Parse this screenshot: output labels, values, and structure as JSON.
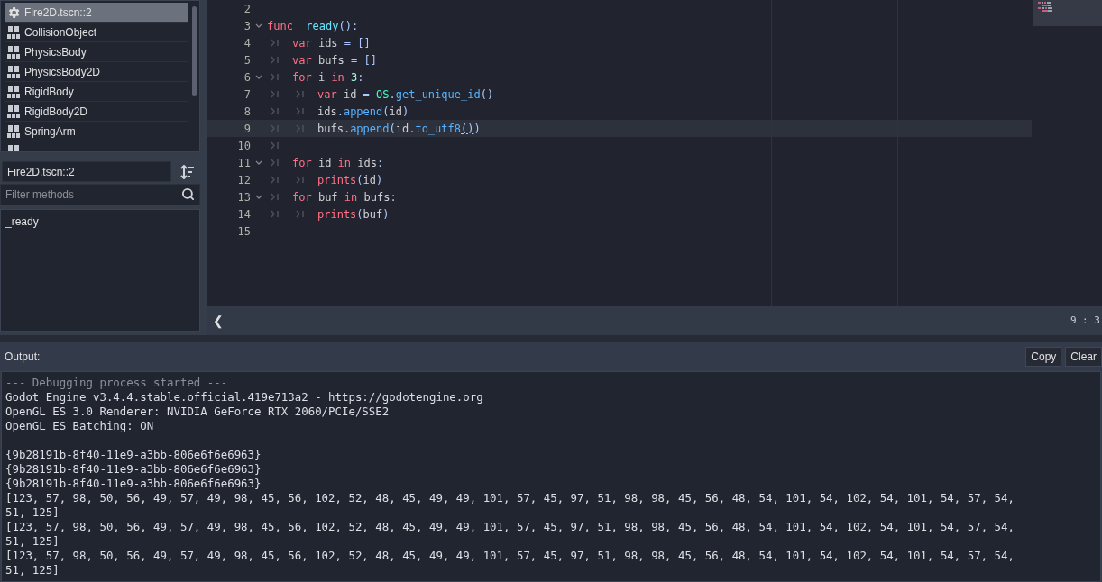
{
  "scene_list": {
    "items": [
      {
        "label": "Fire2D.tscn::2",
        "kind": "script",
        "selected": true
      },
      {
        "label": "CollisionObject",
        "kind": "doc",
        "selected": false
      },
      {
        "label": "PhysicsBody",
        "kind": "doc",
        "selected": false
      },
      {
        "label": "PhysicsBody2D",
        "kind": "doc",
        "selected": false
      },
      {
        "label": "RigidBody",
        "kind": "doc",
        "selected": false
      },
      {
        "label": "RigidBody2D",
        "kind": "doc",
        "selected": false
      },
      {
        "label": "SpringArm",
        "kind": "doc",
        "selected": false
      },
      {
        "kind": "doc",
        "selected": false
      }
    ]
  },
  "script_name": "Fire2D.tscn::2",
  "filter": {
    "placeholder": "Filter methods"
  },
  "methods": [
    "_ready"
  ],
  "code_lines": [
    {
      "number": "2",
      "foldable": false,
      "current": false
    },
    {
      "number": "3",
      "foldable": true,
      "current": false,
      "tokens": [
        {
          "kind": "keyword",
          "text": "func"
        },
        {
          "kind": "function",
          "text": " _ready"
        },
        {
          "kind": "symbol",
          "text": "():"
        }
      ]
    },
    {
      "number": "4",
      "foldable": false,
      "current": false,
      "tokens": [
        {
          "kind": "tab"
        },
        {
          "kind": "keyword",
          "text": "var"
        },
        {
          "kind": "plain",
          "text": " ids "
        },
        {
          "kind": "symbol",
          "text": "= []"
        }
      ]
    },
    {
      "number": "5",
      "foldable": false,
      "current": false,
      "tokens": [
        {
          "kind": "tab"
        },
        {
          "kind": "keyword",
          "text": "var"
        },
        {
          "kind": "plain",
          "text": " bufs "
        },
        {
          "kind": "symbol",
          "text": "= []"
        }
      ]
    },
    {
      "number": "6",
      "foldable": true,
      "current": false,
      "tokens": [
        {
          "kind": "tab"
        },
        {
          "kind": "keyword",
          "text": "for"
        },
        {
          "kind": "plain",
          "text": " i "
        },
        {
          "kind": "keyword",
          "text": "in"
        },
        {
          "kind": "number",
          "text": " 3"
        },
        {
          "kind": "symbol",
          "text": ":"
        }
      ]
    },
    {
      "number": "7",
      "foldable": false,
      "current": false,
      "tokens": [
        {
          "kind": "tab"
        },
        {
          "kind": "tab"
        },
        {
          "kind": "keyword",
          "text": "var"
        },
        {
          "kind": "plain",
          "text": " id "
        },
        {
          "kind": "symbol",
          "text": "= "
        },
        {
          "kind": "class",
          "text": "OS"
        },
        {
          "kind": "symbol",
          "text": "."
        },
        {
          "kind": "method",
          "text": "get_unique_id"
        },
        {
          "kind": "symbol",
          "text": "()"
        }
      ]
    },
    {
      "number": "8",
      "foldable": false,
      "current": false,
      "tokens": [
        {
          "kind": "tab"
        },
        {
          "kind": "tab"
        },
        {
          "kind": "plain",
          "text": "ids"
        },
        {
          "kind": "symbol",
          "text": "."
        },
        {
          "kind": "method",
          "text": "append"
        },
        {
          "kind": "symbol",
          "text": "("
        },
        {
          "kind": "plain",
          "text": "id"
        },
        {
          "kind": "symbol",
          "text": ")"
        }
      ]
    },
    {
      "number": "9",
      "foldable": false,
      "current": true,
      "tokens": [
        {
          "kind": "tab"
        },
        {
          "kind": "tab"
        },
        {
          "kind": "plain",
          "text": "bufs"
        },
        {
          "kind": "symbol",
          "text": "."
        },
        {
          "kind": "method",
          "text": "append"
        },
        {
          "kind": "symbol",
          "text": "("
        },
        {
          "kind": "plain",
          "text": "id"
        },
        {
          "kind": "symbol",
          "text": "."
        },
        {
          "kind": "method",
          "text": "to_utf8"
        },
        {
          "kind": "matched",
          "text": "()"
        },
        {
          "kind": "symbol",
          "text": ")"
        }
      ]
    },
    {
      "number": "10",
      "foldable": false,
      "current": false,
      "tokens": [
        {
          "kind": "tab"
        }
      ]
    },
    {
      "number": "11",
      "foldable": true,
      "current": false,
      "tokens": [
        {
          "kind": "tab"
        },
        {
          "kind": "keyword",
          "text": "for"
        },
        {
          "kind": "plain",
          "text": " id "
        },
        {
          "kind": "keyword",
          "text": "in"
        },
        {
          "kind": "plain",
          "text": " ids"
        },
        {
          "kind": "symbol",
          "text": ":"
        }
      ]
    },
    {
      "number": "12",
      "foldable": false,
      "current": false,
      "tokens": [
        {
          "kind": "tab"
        },
        {
          "kind": "tab"
        },
        {
          "kind": "builtin",
          "text": "prints"
        },
        {
          "kind": "symbol",
          "text": "("
        },
        {
          "kind": "plain",
          "text": "id"
        },
        {
          "kind": "symbol",
          "text": ")"
        }
      ]
    },
    {
      "number": "13",
      "foldable": true,
      "current": false,
      "tokens": [
        {
          "kind": "tab"
        },
        {
          "kind": "keyword",
          "text": "for"
        },
        {
          "kind": "plain",
          "text": " buf "
        },
        {
          "kind": "keyword",
          "text": "in"
        },
        {
          "kind": "plain",
          "text": " bufs"
        },
        {
          "kind": "symbol",
          "text": ":"
        }
      ]
    },
    {
      "number": "14",
      "foldable": false,
      "current": false,
      "tokens": [
        {
          "kind": "tab"
        },
        {
          "kind": "tab"
        },
        {
          "kind": "builtin",
          "text": "prints"
        },
        {
          "kind": "symbol",
          "text": "("
        },
        {
          "kind": "plain",
          "text": "buf"
        },
        {
          "kind": "symbol",
          "text": ")"
        }
      ]
    },
    {
      "number": "15",
      "foldable": false,
      "current": false
    }
  ],
  "editor_status": {
    "back": "❮",
    "position": "9 : 3"
  },
  "output": {
    "title": "Output:",
    "buttons": [
      "Copy",
      "Clear"
    ],
    "lines": [
      {
        "kind": "system",
        "text": "--- Debugging process started ---"
      },
      {
        "kind": "plain",
        "text": "Godot Engine v3.4.4.stable.official.419e713a2 - https://godotengine.org"
      },
      {
        "kind": "plain",
        "text": "OpenGL ES 3.0 Renderer: NVIDIA GeForce RTX 2060/PCIe/SSE2"
      },
      {
        "kind": "plain",
        "text": "OpenGL ES Batching: ON"
      },
      {
        "kind": "blank"
      },
      {
        "kind": "plain",
        "text": "{9b28191b-8f40-11e9-a3bb-806e6f6e6963}"
      },
      {
        "kind": "plain",
        "text": "{9b28191b-8f40-11e9-a3bb-806e6f6e6963}"
      },
      {
        "kind": "plain",
        "text": "{9b28191b-8f40-11e9-a3bb-806e6f6e6963}"
      },
      {
        "kind": "plain",
        "text": "[123, 57, 98, 50, 56, 49, 57, 49, 98, 45, 56, 102, 52, 48, 45, 49, 49, 101, 57, 45, 97, 51, 98, 98, 45, 56, 48, 54, 101, 54, 102, 54, 101, 54, 57, 54,"
      },
      {
        "kind": "plain",
        "text": "51, 125]"
      },
      {
        "kind": "plain",
        "text": "[123, 57, 98, 50, 56, 49, 57, 49, 98, 45, 56, 102, 52, 48, 45, 49, 49, 101, 57, 45, 97, 51, 98, 98, 45, 56, 48, 54, 101, 54, 102, 54, 101, 54, 57, 54,"
      },
      {
        "kind": "plain",
        "text": "51, 125]"
      },
      {
        "kind": "plain",
        "text": "[123, 57, 98, 50, 56, 49, 57, 49, 98, 45, 56, 102, 52, 48, 45, 49, 49, 101, 57, 45, 97, 51, 98, 98, 45, 56, 48, 54, 101, 54, 102, 54, 101, 54, 57, 54,"
      },
      {
        "kind": "plain",
        "text": "51, 125]"
      }
    ]
  }
}
